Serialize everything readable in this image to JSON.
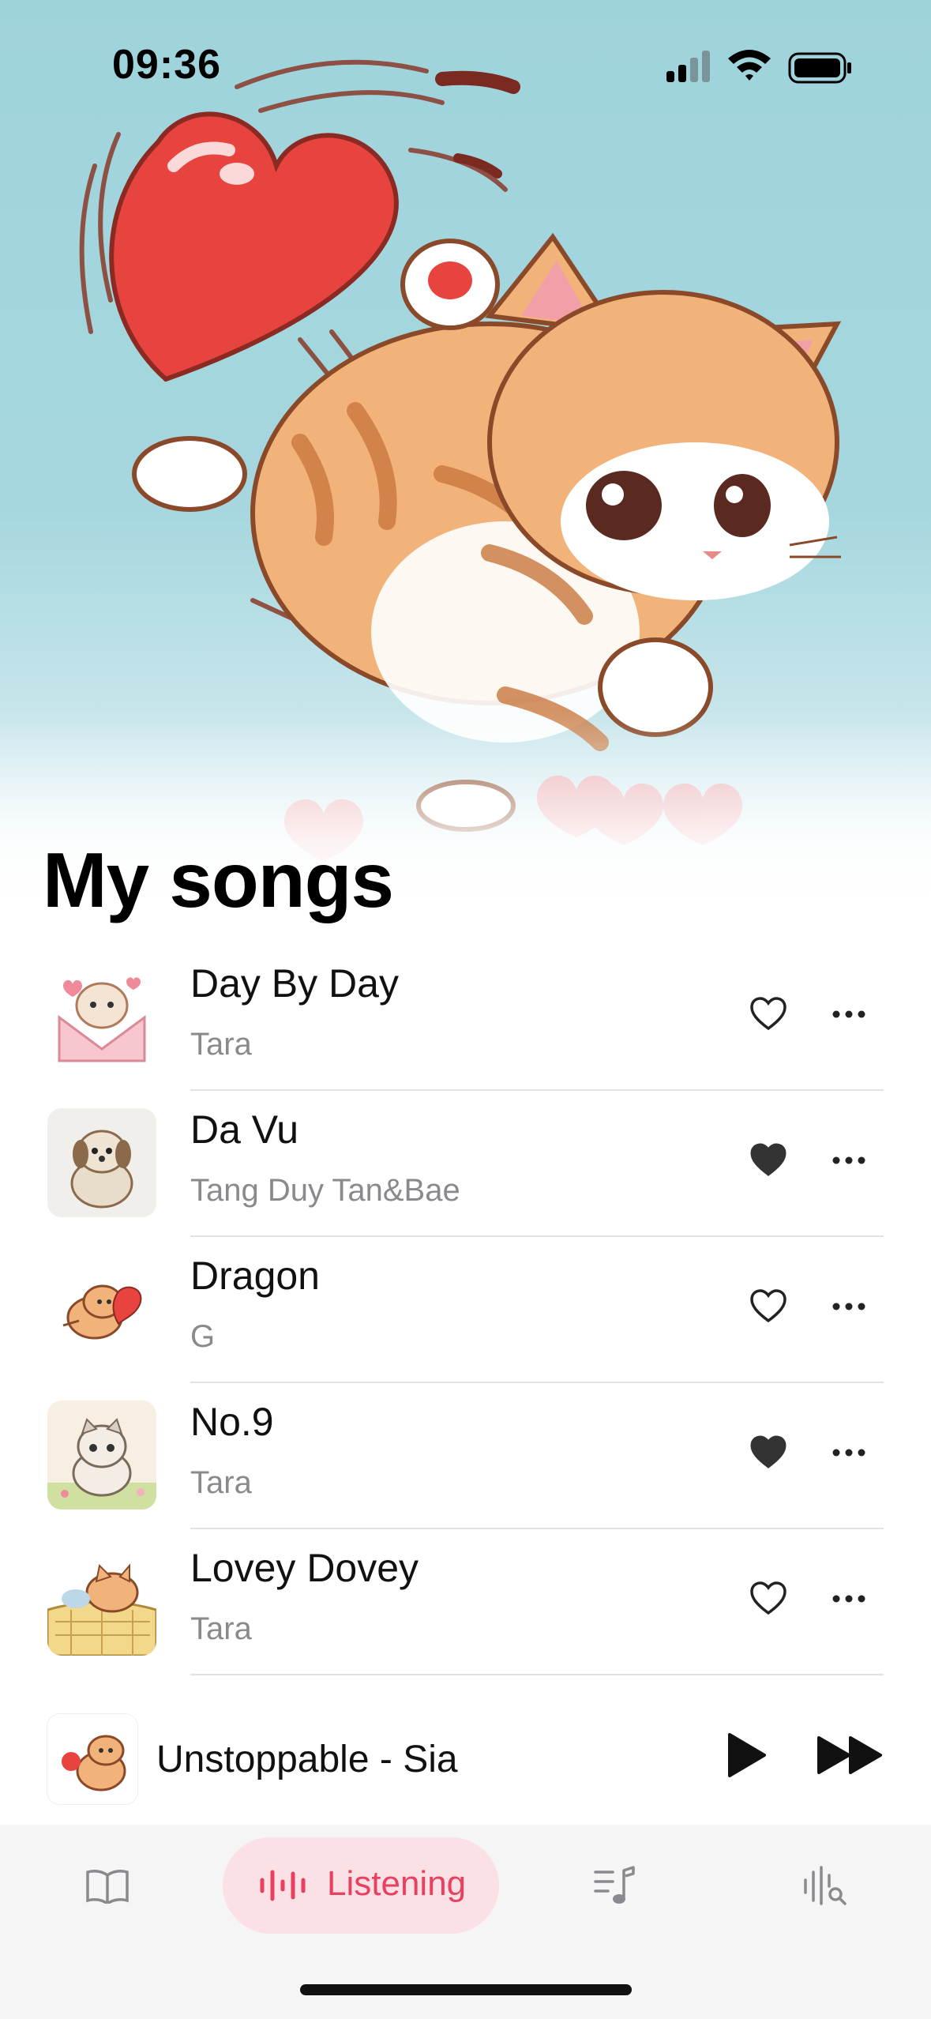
{
  "status_bar": {
    "time": "09:36"
  },
  "page_title": "My songs",
  "songs": [
    {
      "title": "Day By Day",
      "artist": "Tara",
      "liked": false
    },
    {
      "title": "Da Vu",
      "artist": "Tang Duy Tan&Bae",
      "liked": true
    },
    {
      "title": "Dragon",
      "artist": "G",
      "liked": false
    },
    {
      "title": "No.9",
      "artist": "Tara",
      "liked": true
    },
    {
      "title": "Lovey Dovey",
      "artist": "Tara",
      "liked": false
    }
  ],
  "now_playing": {
    "title": "Unstoppable - Sia"
  },
  "tabs": {
    "active_label": "Listening"
  },
  "colors": {
    "accent": "#e8415f",
    "accent_bg": "#fbe0e5",
    "hero_bg": "#9fd3dc"
  }
}
